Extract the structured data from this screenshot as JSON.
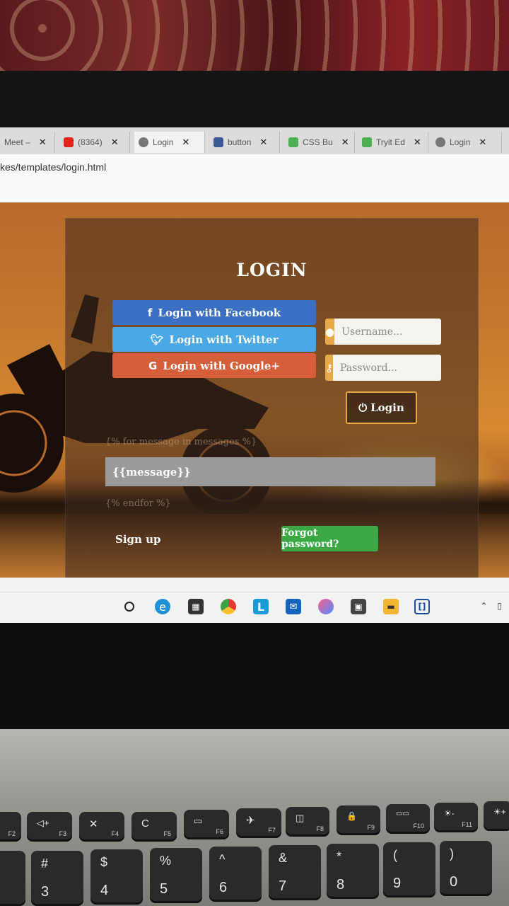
{
  "browser": {
    "tabs": [
      {
        "label": "Meet –",
        "favicon_color": "#1a73e8"
      },
      {
        "label": "(8364)",
        "favicon_color": "#e62117"
      },
      {
        "label": "Login",
        "favicon_color": "#666666"
      },
      {
        "label": "button",
        "favicon_color": "#3b5998"
      },
      {
        "label": "CSS Bu",
        "favicon_color": "#4caf50"
      },
      {
        "label": "Tryit Ed",
        "favicon_color": "#4caf50"
      },
      {
        "label": "Login",
        "favicon_color": "#666666"
      }
    ],
    "close_glyph": "✕",
    "address": "kes/templates/login.html"
  },
  "login": {
    "title": "LOGIN",
    "facebook": "Login with Facebook",
    "twitter": "Login with Twitter",
    "google": "Login with Google+",
    "username_placeholder": "Username...",
    "password_placeholder": "Password...",
    "login_button": "Login",
    "template_for": "{% for message in messages %}",
    "message": "{{message}}",
    "template_endfor": "{% endfor %}",
    "signup": "Sign up",
    "forgot": "Forgot password?"
  },
  "taskbar": {
    "icons": [
      "search-icon",
      "edge-icon",
      "store-icon",
      "chrome-icon",
      "l-app-icon",
      "mail-icon",
      "paint-icon",
      "photos-icon",
      "file-explorer-icon",
      "code-icon"
    ]
  },
  "keyboard": {
    "fn_keys": [
      {
        "glyph": "",
        "label": "F2"
      },
      {
        "glyph": "◁+",
        "label": "F3"
      },
      {
        "glyph": "✕",
        "label": "F4"
      },
      {
        "glyph": "C",
        "label": "F5"
      },
      {
        "glyph": "▭",
        "label": "F6"
      },
      {
        "glyph": "✈",
        "label": "F7"
      },
      {
        "glyph": "◫",
        "label": "F8"
      },
      {
        "glyph": "🔒",
        "label": "F9"
      },
      {
        "glyph": "▭▭",
        "label": "F10"
      },
      {
        "glyph": "☀-",
        "label": "F11"
      },
      {
        "glyph": "☀+",
        "label": ""
      }
    ],
    "num_keys": [
      {
        "top": "",
        "bot": ""
      },
      {
        "top": "#",
        "bot": "3"
      },
      {
        "top": "$",
        "bot": "4"
      },
      {
        "top": "%",
        "bot": "5"
      },
      {
        "top": "^",
        "bot": "6"
      },
      {
        "top": "&",
        "bot": "7"
      },
      {
        "top": "*",
        "bot": "8"
      },
      {
        "top": "(",
        "bot": "9"
      },
      {
        "top": ")",
        "bot": "0"
      }
    ]
  }
}
